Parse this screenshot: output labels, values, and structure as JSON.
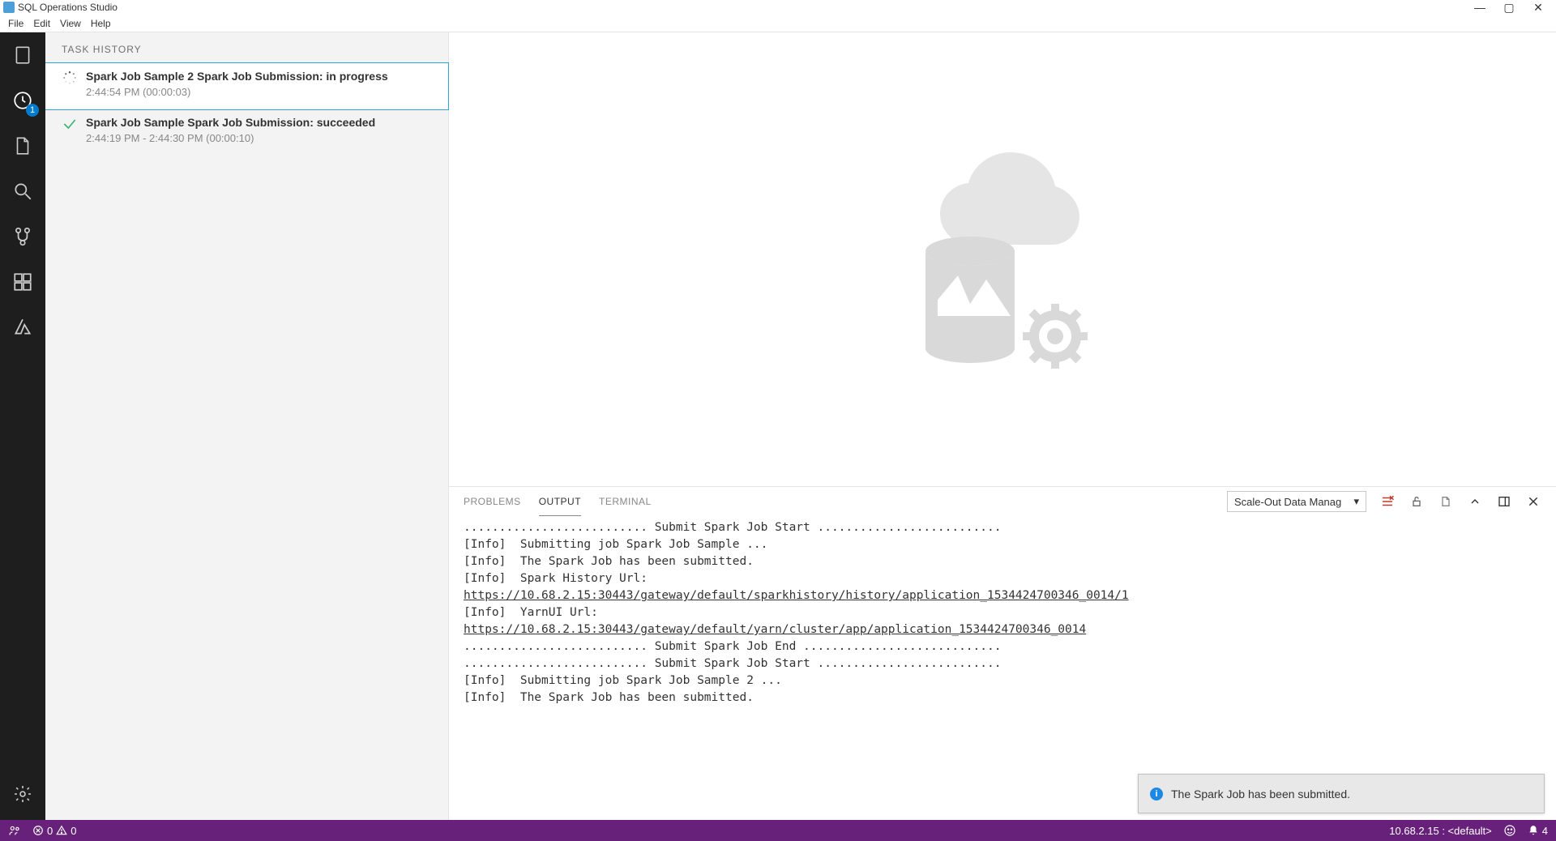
{
  "window": {
    "title": "SQL Operations Studio"
  },
  "menu": {
    "file": "File",
    "edit": "Edit",
    "view": "View",
    "help": "Help"
  },
  "activity": {
    "history_badge": "1"
  },
  "sidepanel": {
    "title": "TASK HISTORY",
    "tasks": [
      {
        "status": "in-progress",
        "title": "Spark Job Sample 2 Spark Job Submission: in progress",
        "time": "2:44:54 PM (00:00:03)"
      },
      {
        "status": "succeeded",
        "title": "Spark Job Sample Spark Job Submission: succeeded",
        "time": "2:44:19 PM - 2:44:30 PM (00:00:10)"
      }
    ]
  },
  "panel": {
    "tabs": {
      "problems": "PROBLEMS",
      "output": "OUTPUT",
      "terminal": "TERMINAL"
    },
    "channel_selected": "Scale-Out Data Manag",
    "output": {
      "line1": ".......................... Submit Spark Job Start ..........................",
      "line2": "[Info]  Submitting job Spark Job Sample ...",
      "line3": "[Info]  The Spark Job has been submitted.",
      "line4": "[Info]  Spark History Url:",
      "line5": "https://10.68.2.15:30443/gateway/default/sparkhistory/history/application_1534424700346_0014/1",
      "line6": "[Info]  YarnUI Url:",
      "line7": "https://10.68.2.15:30443/gateway/default/yarn/cluster/app/application_1534424700346_0014",
      "line8": ".......................... Submit Spark Job End ............................",
      "line9": ".......................... Submit Spark Job Start ..........................",
      "line10": "[Info]  Submitting job Spark Job Sample 2 ...",
      "line11": "[Info]  The Spark Job has been submitted."
    }
  },
  "toast": {
    "message": "The Spark Job has been submitted."
  },
  "statusbar": {
    "errors": "0",
    "warnings": "0",
    "connection": "10.68.2.15 : <default>",
    "notifications": "4"
  }
}
